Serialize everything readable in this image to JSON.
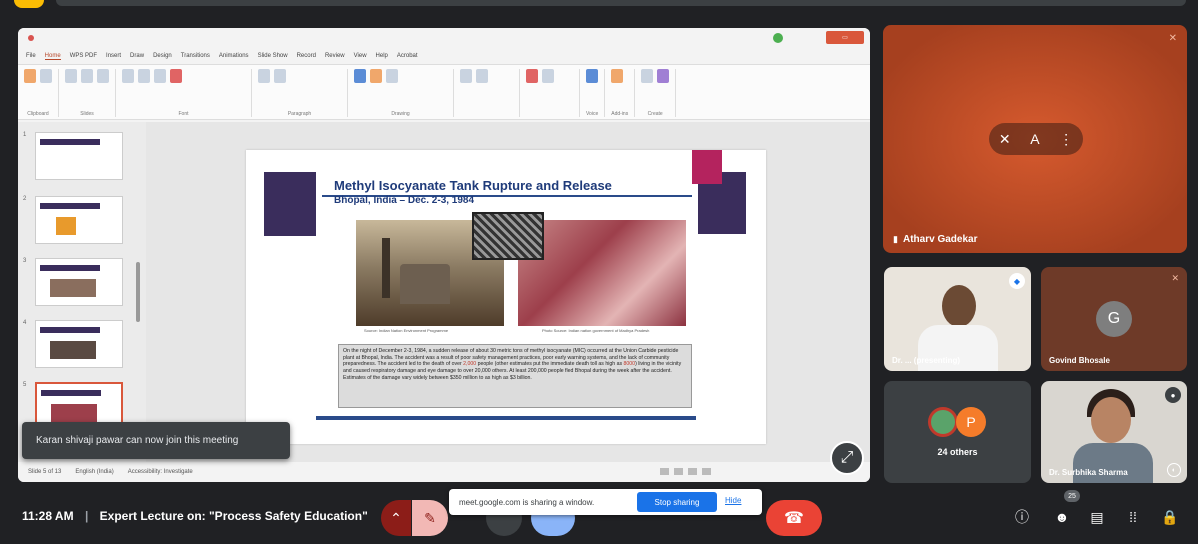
{
  "presentation": {
    "menu": [
      "File",
      "Home",
      "WPS PDF",
      "Insert",
      "Draw",
      "Design",
      "Transitions",
      "Animations",
      "Slide Show",
      "Record",
      "Review",
      "View",
      "Help",
      "Acrobat"
    ],
    "ribbon_groups": [
      "Clipboard",
      "Slides",
      "Font",
      "Paragraph",
      "Drawing",
      "Voice",
      "Add-ins",
      "Create"
    ],
    "slide_numbers": [
      "1",
      "2",
      "3",
      "4",
      "5"
    ],
    "slide": {
      "title": "Methyl Isocyanate Tank Rupture and Release",
      "subtitle": "Bhopal, India – Dec. 2-3, 1984",
      "caption_left": "Source: Indian Nation Environment Programme",
      "caption_right": "Photo Source: Indian nation government of Madhya Pradesh",
      "body_a": "On the night of December 2-3, 1984, a sudden release of about 30 metric tons of methyl isocyanate (MIC) occurred at the Union Carbide pesticide plant at Bhopal, India. The accident was a result of poor safety management practices, poor early warning systems, and the lack of community preparedness. The accident led to the death of over ",
      "body_red1": "2,000",
      "body_b": " people (other estimates put the immediate death toll as high as ",
      "body_red2": "8000",
      "body_c": ") living in the vicinity and caused respiratory damage and eye damage to over 20,000 others. At least 200,000 people fled Bhopal during the week after the accident. Estimates of the damage vary widely between $350 million to as high as $3 billion."
    },
    "status_left": "Slide 5 of 13",
    "status_lang": "English (India)",
    "status_access": "Accessibility: Investigate"
  },
  "toast": "Karan shivaji pawar can now join this meeting",
  "tiles": {
    "main_name": "Atharv Gadekar",
    "main_letter": "A",
    "v1_name": "Dr. ... (presenting)",
    "g_letter": "G",
    "g_name": "Govind Bhosale",
    "others_letter": "P",
    "others_count": "24 others",
    "v2_name": "Dr. Surbhika Sharma"
  },
  "bottombar": {
    "time": "11:28 AM",
    "separator": "|",
    "meeting_title": "Expert Lecture on: \"Process Safety Education\"",
    "share_text": "meet.google.com is sharing a window.",
    "stop_sharing": "Stop sharing",
    "hide": "Hide",
    "participants_count": "25"
  },
  "icons": {
    "chevron": "chevron-up-icon",
    "mic_off": "mic-off-icon",
    "end_call": "phone-end-icon",
    "info": "info-icon",
    "people": "people-icon",
    "chat": "chat-icon",
    "activities": "apps-icon",
    "lock": "host-controls-icon"
  },
  "colors": {
    "meet_bg": "#202124",
    "end_call": "#ea4335",
    "accent_blue": "#1a73e8",
    "slide_title": "#1f3b7a",
    "deco_purple": "#3a2d5c",
    "deco_magenta": "#b4235e",
    "main_tile": "#c9542a"
  }
}
